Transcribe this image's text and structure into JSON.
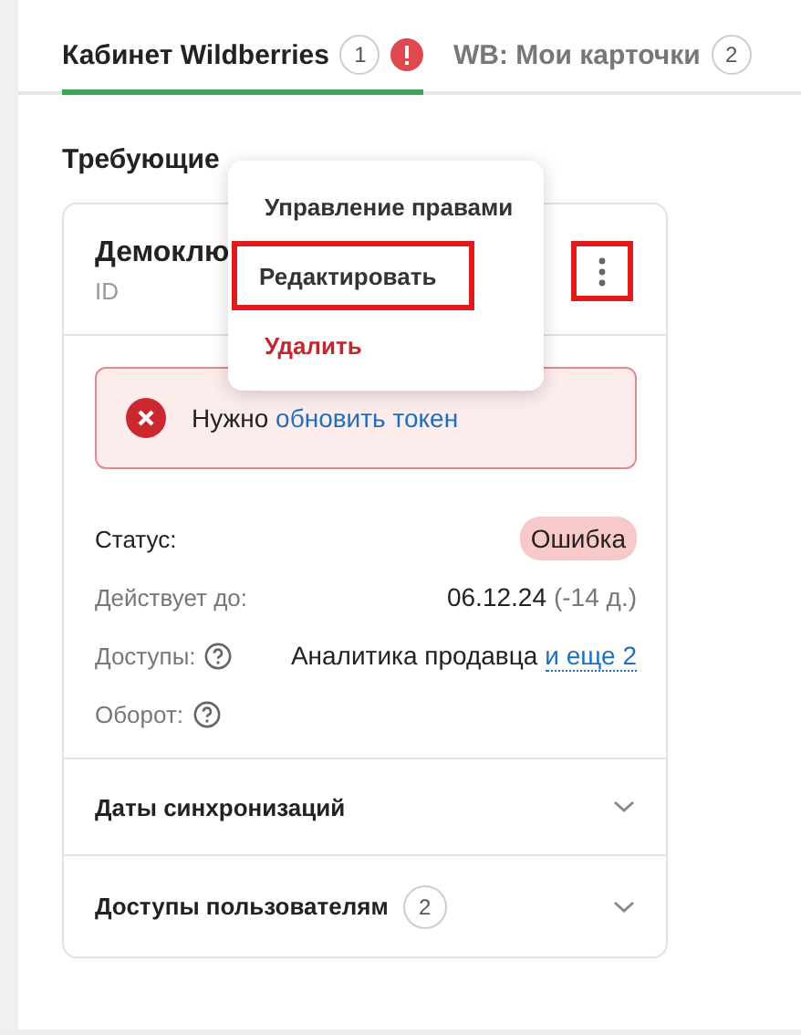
{
  "tabs": [
    {
      "label": "Кабинет Wildberries",
      "count": "1",
      "alert": true,
      "selected": true
    },
    {
      "label": "WB: Мои карточки",
      "count": "2",
      "alert": false,
      "selected": false
    }
  ],
  "section_title": "Требующие",
  "card": {
    "title": "Демоклю",
    "subtitle": "ID",
    "menu_button_highlighted": true,
    "alert": {
      "text": "Нужно",
      "link": "обновить токен"
    },
    "fields": [
      {
        "kind": "badge",
        "label": "Статус:",
        "value": "Ошибка",
        "help": false
      },
      {
        "kind": "date",
        "label": "Действует до:",
        "value": "06.12.24",
        "note": "(-14 д.)",
        "help": false
      },
      {
        "kind": "link",
        "label": "Доступы:",
        "value": "Аналитика продавца",
        "link": "и еще 2",
        "help": true
      },
      {
        "kind": "empty",
        "label": "Оборот:",
        "help": true
      }
    ],
    "sections": [
      {
        "title": "Даты синхронизаций",
        "expanded": false
      },
      {
        "title": "Доступы пользователям",
        "count": "2",
        "expanded": false
      }
    ]
  },
  "menu": [
    {
      "label": "Управление правами",
      "kind": "normal",
      "highlighted": false
    },
    {
      "label": "Редактировать",
      "kind": "normal",
      "highlighted": true
    },
    {
      "label": "Удалить",
      "kind": "danger",
      "highlighted": false
    }
  ]
}
